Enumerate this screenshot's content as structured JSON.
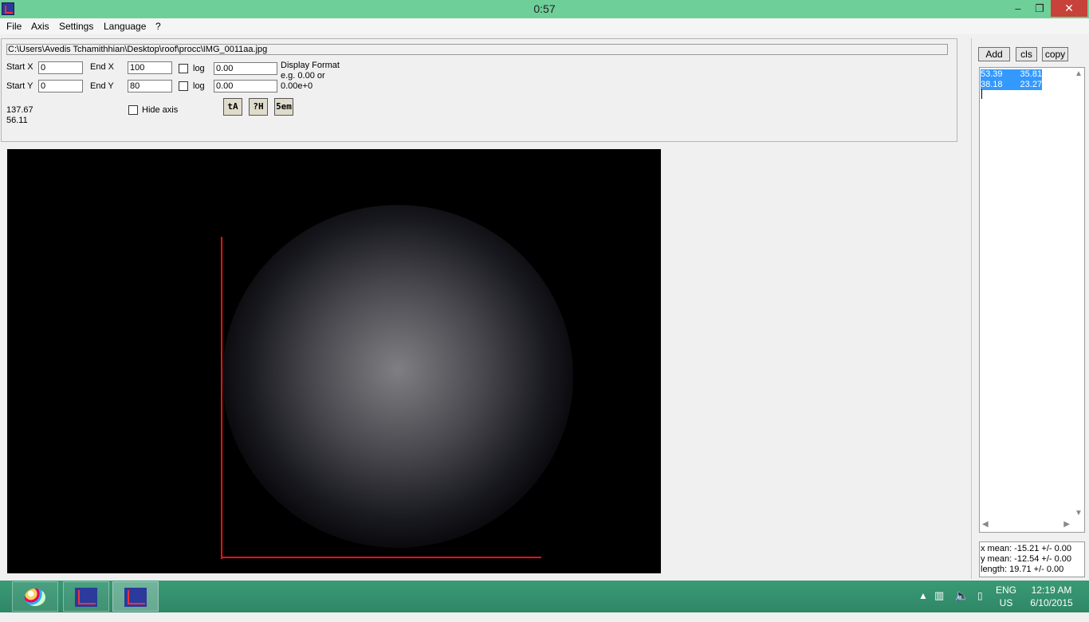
{
  "window": {
    "title": "0:57",
    "min": "–",
    "max": "❐",
    "close": "✕"
  },
  "menu": [
    "File",
    "Axis",
    "Settings",
    "Language",
    "?"
  ],
  "path": "C:\\Users\\Avedis Tchamithhian\\Desktop\\roof\\procc\\IMG_0011aa.jpg",
  "axis": {
    "start_x_label": "Start X",
    "start_x": "0",
    "end_x_label": "End X",
    "end_x": "100",
    "start_y_label": "Start Y",
    "start_y": "0",
    "end_y_label": "End Y",
    "end_y": "80",
    "log_label": "log",
    "format_x": "0.00",
    "format_y": "0.00",
    "display_format_1": "Display Format",
    "display_format_2": "e.g. 0.00 or",
    "display_format_3": "0.00e+0"
  },
  "coords": {
    "x": "137.67",
    "y": "56.11"
  },
  "hide_axis_label": "Hide axis",
  "tools": [
    "tA",
    "?H",
    "5em"
  ],
  "right_panel": {
    "add": "Add",
    "cls": "cls",
    "copy": "copy",
    "rows": [
      {
        "x": "53.39",
        "y": "35.81"
      },
      {
        "x": "38.18",
        "y": "23.27"
      }
    ],
    "stats": [
      "x mean: -15.21 +/- 0.00",
      "y mean: -12.54 +/- 0.00",
      "length: 19.71 +/- 0.00"
    ]
  },
  "taskbar": {
    "lang1": "ENG",
    "lang2": "US",
    "time": "12:19 AM",
    "date": "6/10/2015"
  },
  "colors": {
    "titlebar": "#6fcf99",
    "axis_line": "#ee1111",
    "selection": "#3399ff",
    "taskbar": "#2f8766"
  },
  "icons": {
    "app": "graph-axis-icon",
    "tray": [
      "chevron-up-icon",
      "network-icon",
      "speaker-icon",
      "battery-icon"
    ]
  }
}
